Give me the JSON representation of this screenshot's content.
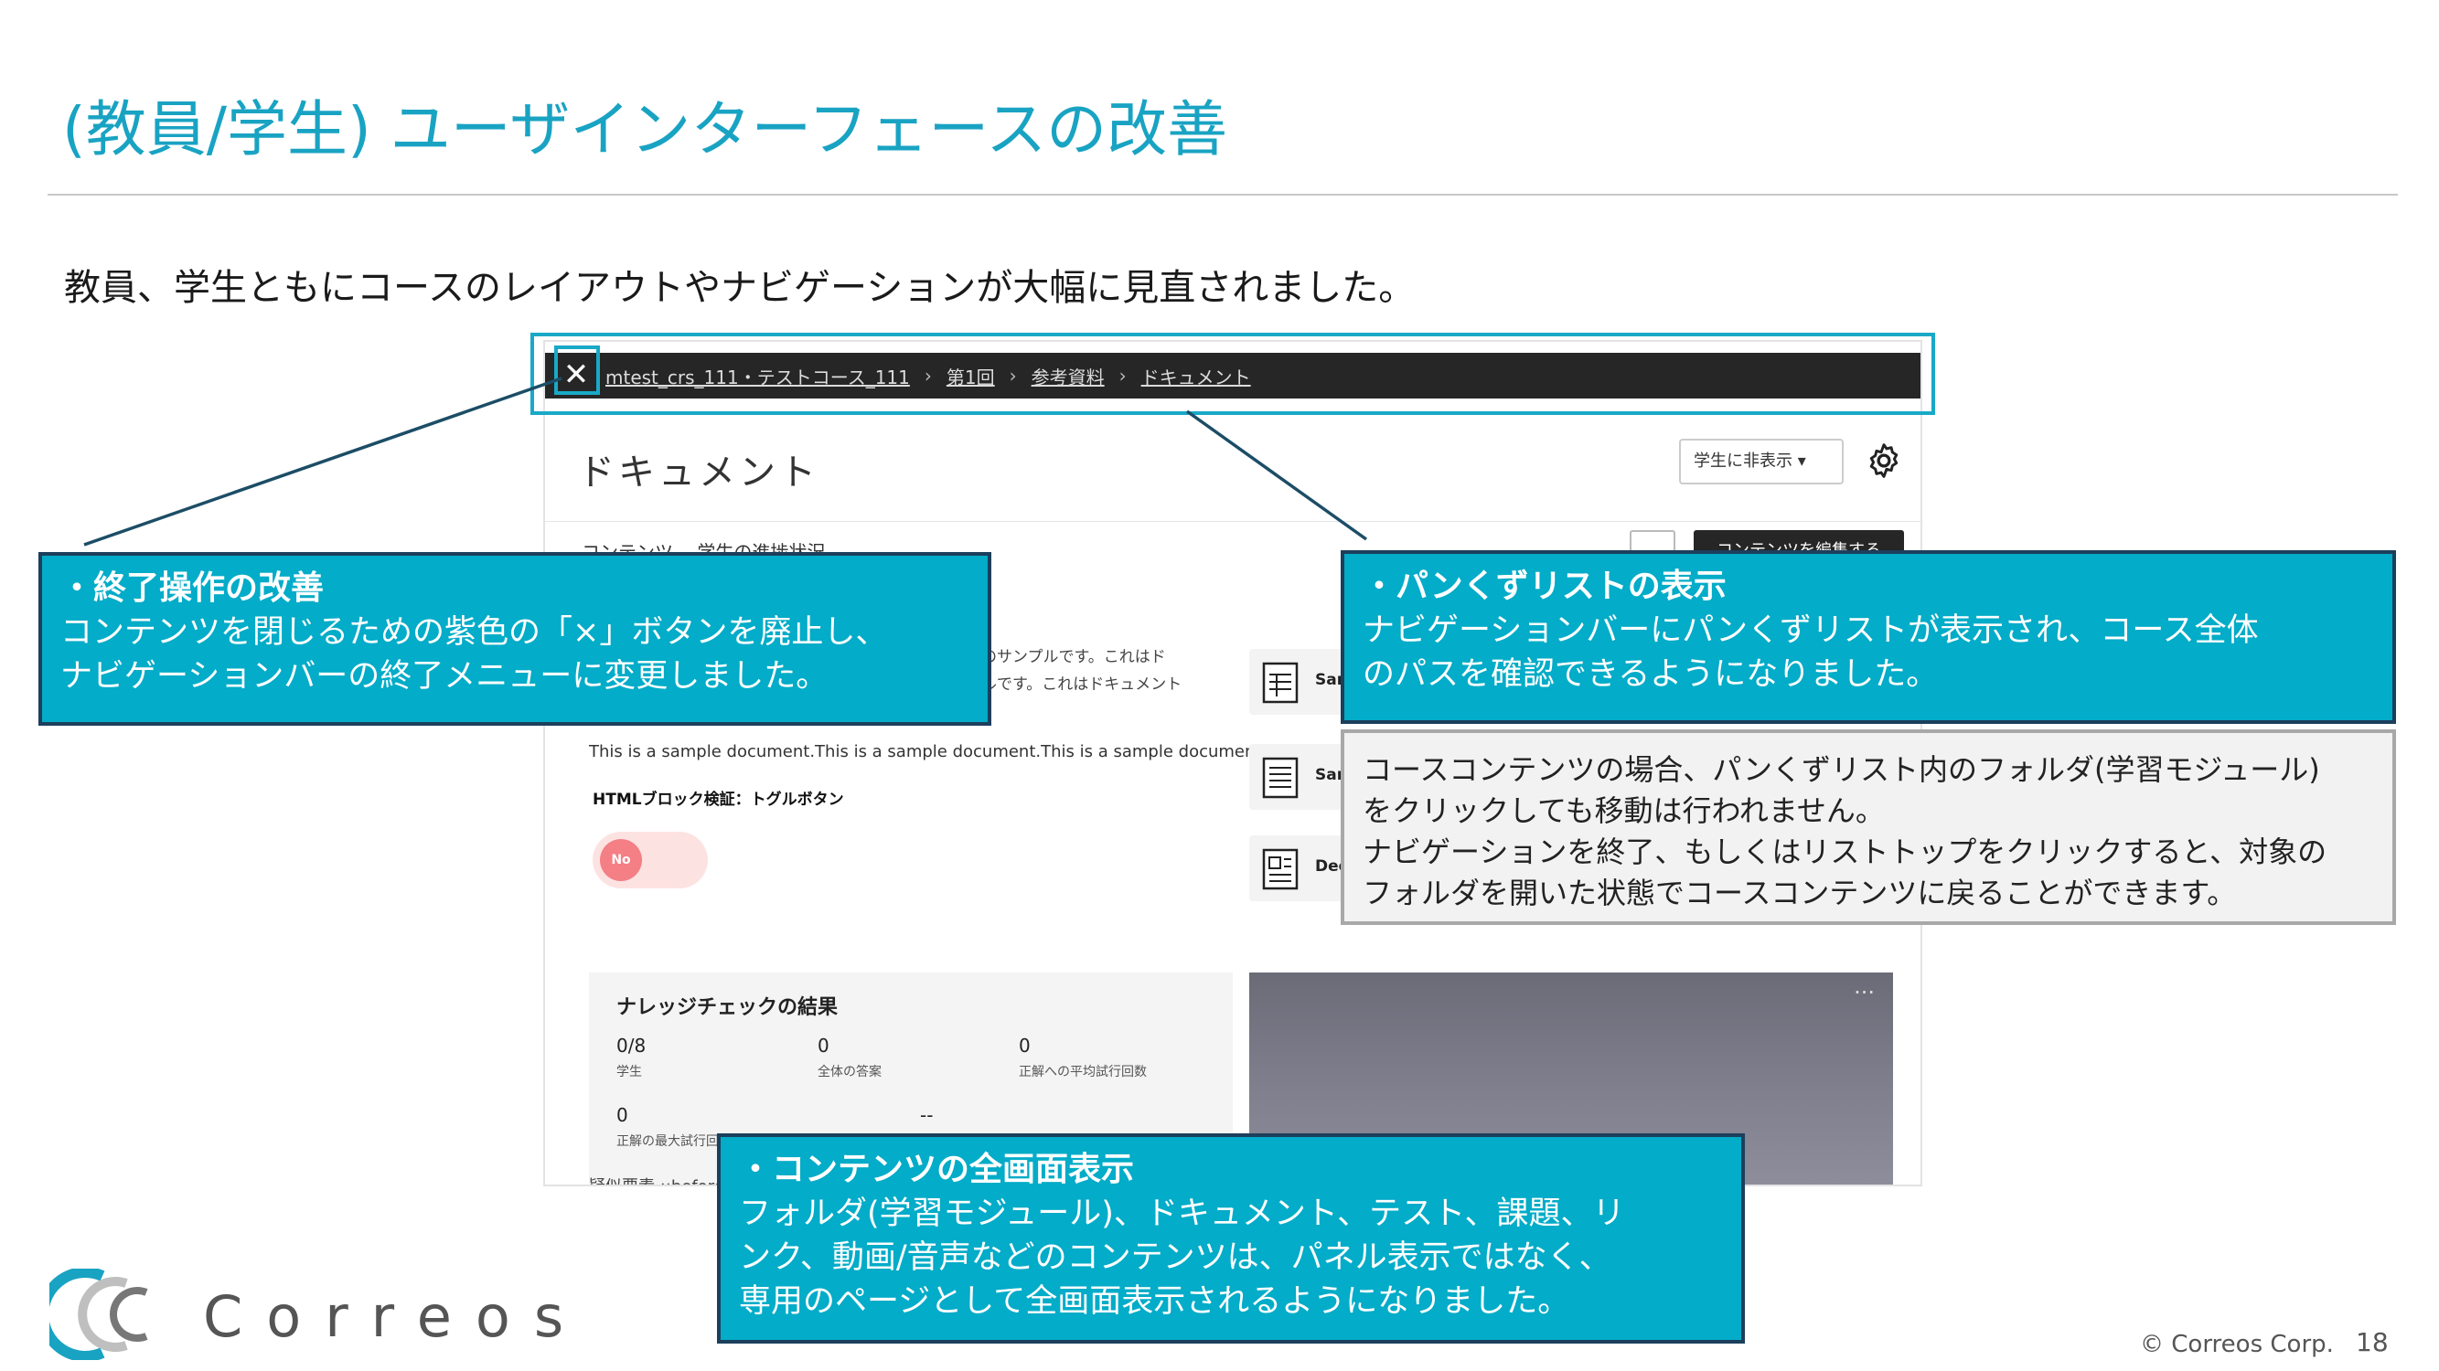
{
  "slide": {
    "title": "(教員/学生) ユーザインターフェースの改善",
    "subtitle": "教員、学生ともにコースのレイアウトやナビゲーションが大幅に見直されました。",
    "page_number": "18",
    "copyright": "© Correos Corp.",
    "logo_text": "Correos"
  },
  "screenshot": {
    "close_glyph": "✕",
    "breadcrumbs": [
      "mtest_crs_111・テストコース_111",
      "第1回",
      "参考資料",
      "ドキュメント"
    ],
    "crumb_separator": "›",
    "doc_title": "ドキュメント",
    "visibility_select": "学生に非表示 ▾",
    "tabs": "コンテンツ　 学生の進捗状況",
    "edit_button": "コンテンツを編集する",
    "doc_snippet_1": "トのサンプルです。これはド",
    "doc_snippet_2": "プルです。これはドキュメント",
    "doc_text": "This is a sample document.This is a sample document.This is a sample document.",
    "html_block_label": "HTMLブロック検証：トグルボタン",
    "toggle_label": "No",
    "files": [
      "Sar",
      "Sar",
      "Dee"
    ],
    "knowledge_check": {
      "title": "ナレッジチェックの結果",
      "stats": [
        {
          "value": "0/8",
          "caption": "学生"
        },
        {
          "value": "0",
          "caption": "全体の答案"
        },
        {
          "value": "0",
          "caption": "正解への平均試行回数"
        },
        {
          "value": "0",
          "caption": "正解の最大試行回"
        },
        {
          "value": "--",
          "caption": ""
        }
      ]
    },
    "bottom_cut_text": "疑似要素 ::before",
    "photo_menu": "···"
  },
  "callouts": {
    "close": {
      "heading": "・終了操作の改善",
      "lines": [
        "コンテンツを閉じるための紫色の「×」ボタンを廃止し、",
        "ナビゲーションバーの終了メニューに変更しました。"
      ]
    },
    "breadcrumb": {
      "heading": "・パンくずリストの表示",
      "lines": [
        "ナビゲーションバーにパンくずリストが表示され、コース全体",
        "のパスを確認できるようになりました。"
      ]
    },
    "fullscreen": {
      "heading": "・コンテンツの全画面表示",
      "lines": [
        "フォルダ(学習モジュール)、ドキュメント、テスト、課題、リ",
        "ンク、動画/音声などのコンテンツは、パネル表示ではなく、",
        "専用のページとして全画面表示されるようになりました。"
      ]
    }
  },
  "note": {
    "lines": [
      "コースコンテンツの場合、パンくずリスト内のフォルダ(学習モジュール)",
      "をクリックしても移動は行われません。",
      "ナビゲーションを終了、もしくはリストトップをクリックすると、対象の",
      "フォルダを開いた状態でコースコンテンツに戻ることができます。"
    ]
  },
  "colors": {
    "accent": "#19a3c3",
    "callout_bg": "#03acc8",
    "callout_border": "#1c3f5c",
    "navbar": "#262626"
  }
}
